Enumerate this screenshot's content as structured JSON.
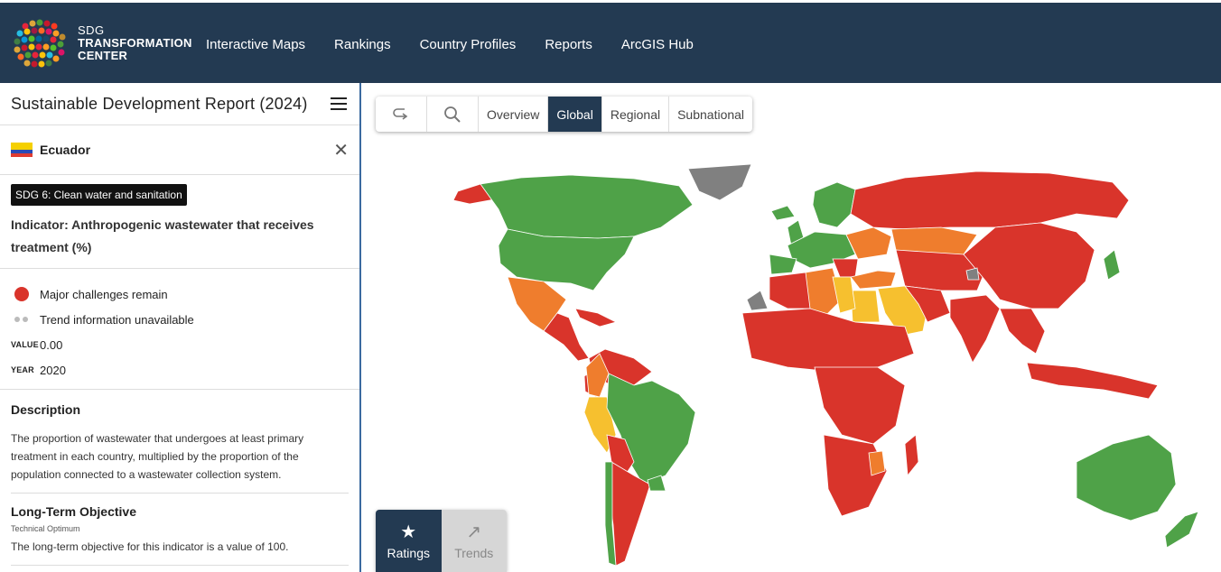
{
  "header": {
    "brand_line1": "SDG",
    "brand_line2": "TRANSFORMATION",
    "brand_line3": "CENTER",
    "nav": [
      "Interactive Maps",
      "Rankings",
      "Country Profiles",
      "Reports",
      "ArcGIS Hub"
    ]
  },
  "sidebar": {
    "title": "Sustainable Development Report (2024)",
    "country": "Ecuador",
    "sdg_tag": "SDG 6: Clean water and sanitation",
    "indicator": "Indicator: Anthropogenic wastewater that receives treatment (%)",
    "rating_text": "Major challenges remain",
    "trend_text": "Trend information unavailable",
    "value_label": "VALUE",
    "value": "0.00",
    "year_label": "YEAR",
    "year": "2020",
    "description_heading": "Description",
    "description": "The proportion of wastewater that undergoes at least primary treatment in each country, multiplied by the proportion of the population connected to a wastewater collection system.",
    "objective_heading": "Long-Term Objective",
    "objective_sub": "Technical Optimum",
    "objective_text": "The long-term objective for this indicator is a value of 100."
  },
  "map_toolbar": {
    "tabs": [
      "Overview",
      "Global",
      "Regional",
      "Subnational"
    ],
    "active_tab": "Global"
  },
  "modes": {
    "ratings": "Ratings",
    "trends": "Trends"
  },
  "colors": {
    "header_bg": "#233a52",
    "red": "#d9342b",
    "orange": "#ef7d2d",
    "yellow": "#f6c02f",
    "green": "#4fa248",
    "grey": "#808080"
  }
}
